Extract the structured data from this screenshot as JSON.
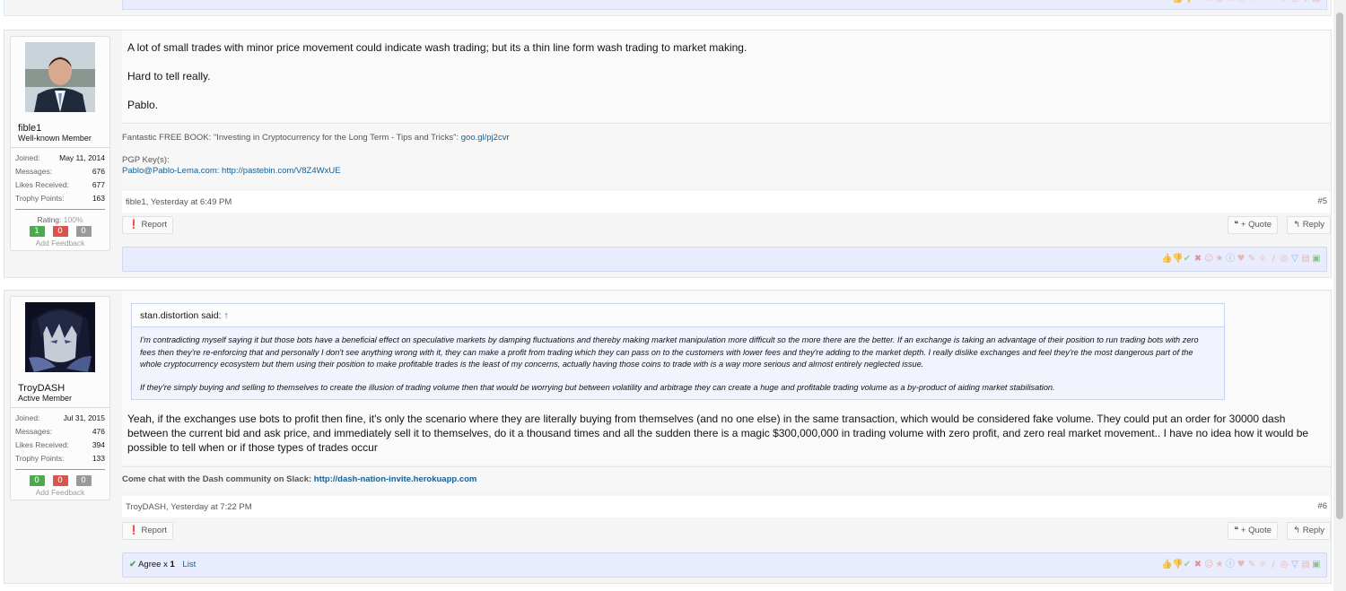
{
  "posts": [
    {
      "user": {
        "name": "fible1",
        "title": "Well-known Member",
        "joined_label": "Joined:",
        "joined": "May 11, 2014",
        "messages_label": "Messages:",
        "messages": "676",
        "likes_label": "Likes Received:",
        "likes": "677",
        "trophy_label": "Trophy Points:",
        "trophy": "163",
        "rating_label": "Rating:",
        "rating_pct": "100%",
        "fb_pos": "1",
        "fb_neg": "0",
        "fb_neu": "0",
        "add_feedback": "Add Feedback"
      },
      "body": [
        "A lot of small trades with minor price movement could indicate wash trading; but its a thin line form wash trading to market making.",
        "Hard to tell really.",
        "Pablo."
      ],
      "signature": {
        "book_text": "Fantastic FREE BOOK: \"Investing in Cryptocurrency for the Long Term - Tips and Tricks\":",
        "book_link": "goo.gl/pj2cvr",
        "pgp_label": "PGP Key(s):",
        "pgp_link": "Pablo@Pablo-Lema.com: http://pastebin.com/V8Z4WxUE"
      },
      "meta": {
        "author_time": "fible1, Yesterday at 6:49 PM",
        "number": "#5"
      },
      "actions": {
        "report": "Report",
        "quote": "+ Quote",
        "reply": "Reply"
      }
    },
    {
      "user": {
        "name": "TroyDASH",
        "title": "Active Member",
        "joined_label": "Joined:",
        "joined": "Jul 31, 2015",
        "messages_label": "Messages:",
        "messages": "476",
        "likes_label": "Likes Received:",
        "likes": "394",
        "trophy_label": "Trophy Points:",
        "trophy": "133",
        "fb_pos": "0",
        "fb_neg": "0",
        "fb_neu": "0",
        "add_feedback": "Add Feedback"
      },
      "quote": {
        "author": "stan.distortion said:",
        "arrow": "↑",
        "p1": "I'm contradicting myself saying it but those bots have a beneficial effect on speculative markets by damping fluctuations and thereby making market manipulation more difficult so the more there are the better. If an exchange is taking an advantage of their position to run trading bots with zero fees then they're re-enforcing that and personally I don't see anything wrong with it, they can make a profit from trading which they can pass on to the customers with lower fees and they're adding to the market depth. I really dislike exchanges and feel they're the most dangerous part of the whole cryptocurrency ecosystem but them using their position to make profitable trades is the least of my concerns, actually having those coins to trade with is a way more serious and almost entirely neglected issue.",
        "p2": "If they're simply buying and selling to themselves to create the illusion of trading volume then that would be worrying but between volatility and arbitrage they can create a huge and profitable trading volume as a by-product of aiding market stabilisation."
      },
      "body": [
        "Yeah, if the exchanges use bots to profit then fine, it's only the scenario where they are literally buying from themselves (and no one else) in the same transaction, which would be considered fake volume. They could put an order for 30000 dash between the current bid and ask price, and immediately sell it to themselves, do it a thousand times and all the sudden there is a magic $300,000,000 in trading volume with zero profit, and zero real market movement.. I have no idea how it would be possible to tell when or if those types of trades occur"
      ],
      "signature": {
        "text": "Come chat with the Dash community on Slack:",
        "link": "http://dash-nation-invite.herokuapp.com"
      },
      "meta": {
        "author_time": "TroyDASH, Yesterday at 7:22 PM",
        "number": "#6"
      },
      "actions": {
        "report": "Report",
        "quote": "+ Quote",
        "reply": "Reply"
      },
      "likes": {
        "agree_label": "Agree x",
        "agree_count": "1",
        "list_link": "List"
      }
    }
  ],
  "reactions": [
    "like",
    "dislike",
    "agree",
    "disagree",
    "funny",
    "winner",
    "informative",
    "love",
    "useful",
    "creative",
    "optimistic",
    "friendly",
    "ratings",
    "meta"
  ],
  "colors": {
    "accent": "#176093",
    "like_bar": "#e8ecfc",
    "positive": "#4caa4c",
    "negative": "#d9534f",
    "neutral": "#999999"
  }
}
